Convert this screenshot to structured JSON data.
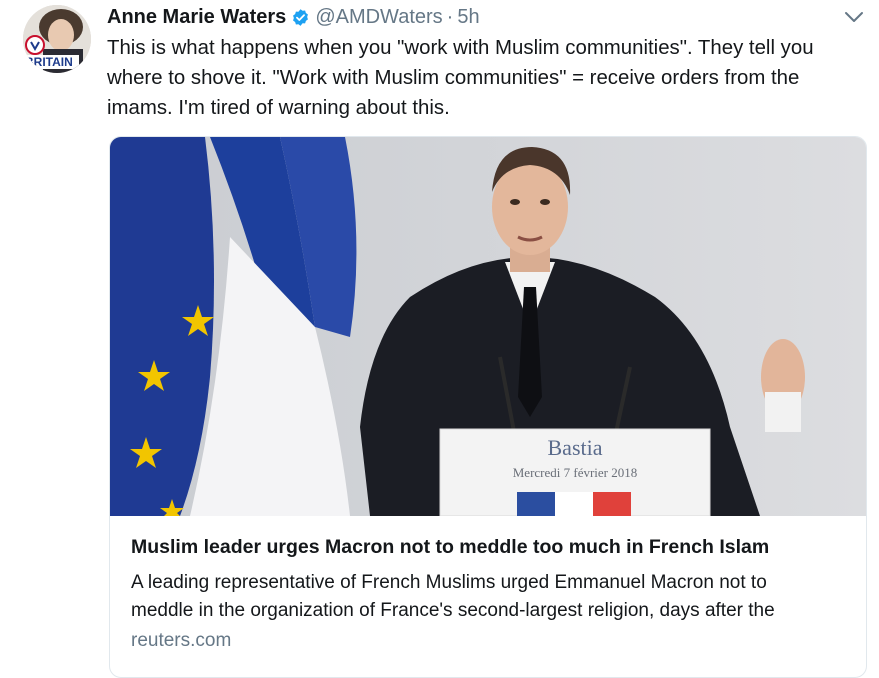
{
  "tweet": {
    "author_name": "Anne Marie Waters",
    "handle": "@AMDWaters",
    "separator": "·",
    "timestamp": "5h",
    "avatar_caption": "BRITAIN",
    "text_lines": [
      "This is what happens when you \"work with Muslim communities\".  They tell you",
      "where to shove it.  \"Work with Muslim communities\" = receive orders from the",
      "imams.  I'm tired of warning about this."
    ]
  },
  "card": {
    "podium_title": "Bastia",
    "podium_date": "Mercredi 7 février 2018",
    "title": "Muslim leader urges Macron not to meddle too much in French Islam",
    "description_lines": [
      "A leading representative of French Muslims urged Emmanuel Macron not to",
      "meddle in the organization of France's second-largest religion, days after the"
    ],
    "domain": "reuters.com"
  },
  "colors": {
    "verified_blue": "#1da1f2",
    "secondary_text": "#657786",
    "card_border": "#e1e8ed",
    "eu_blue": "#1f3a93",
    "flag_red": "#e0413b"
  },
  "icons": [
    "verified-badge-icon",
    "chevron-down-icon"
  ]
}
